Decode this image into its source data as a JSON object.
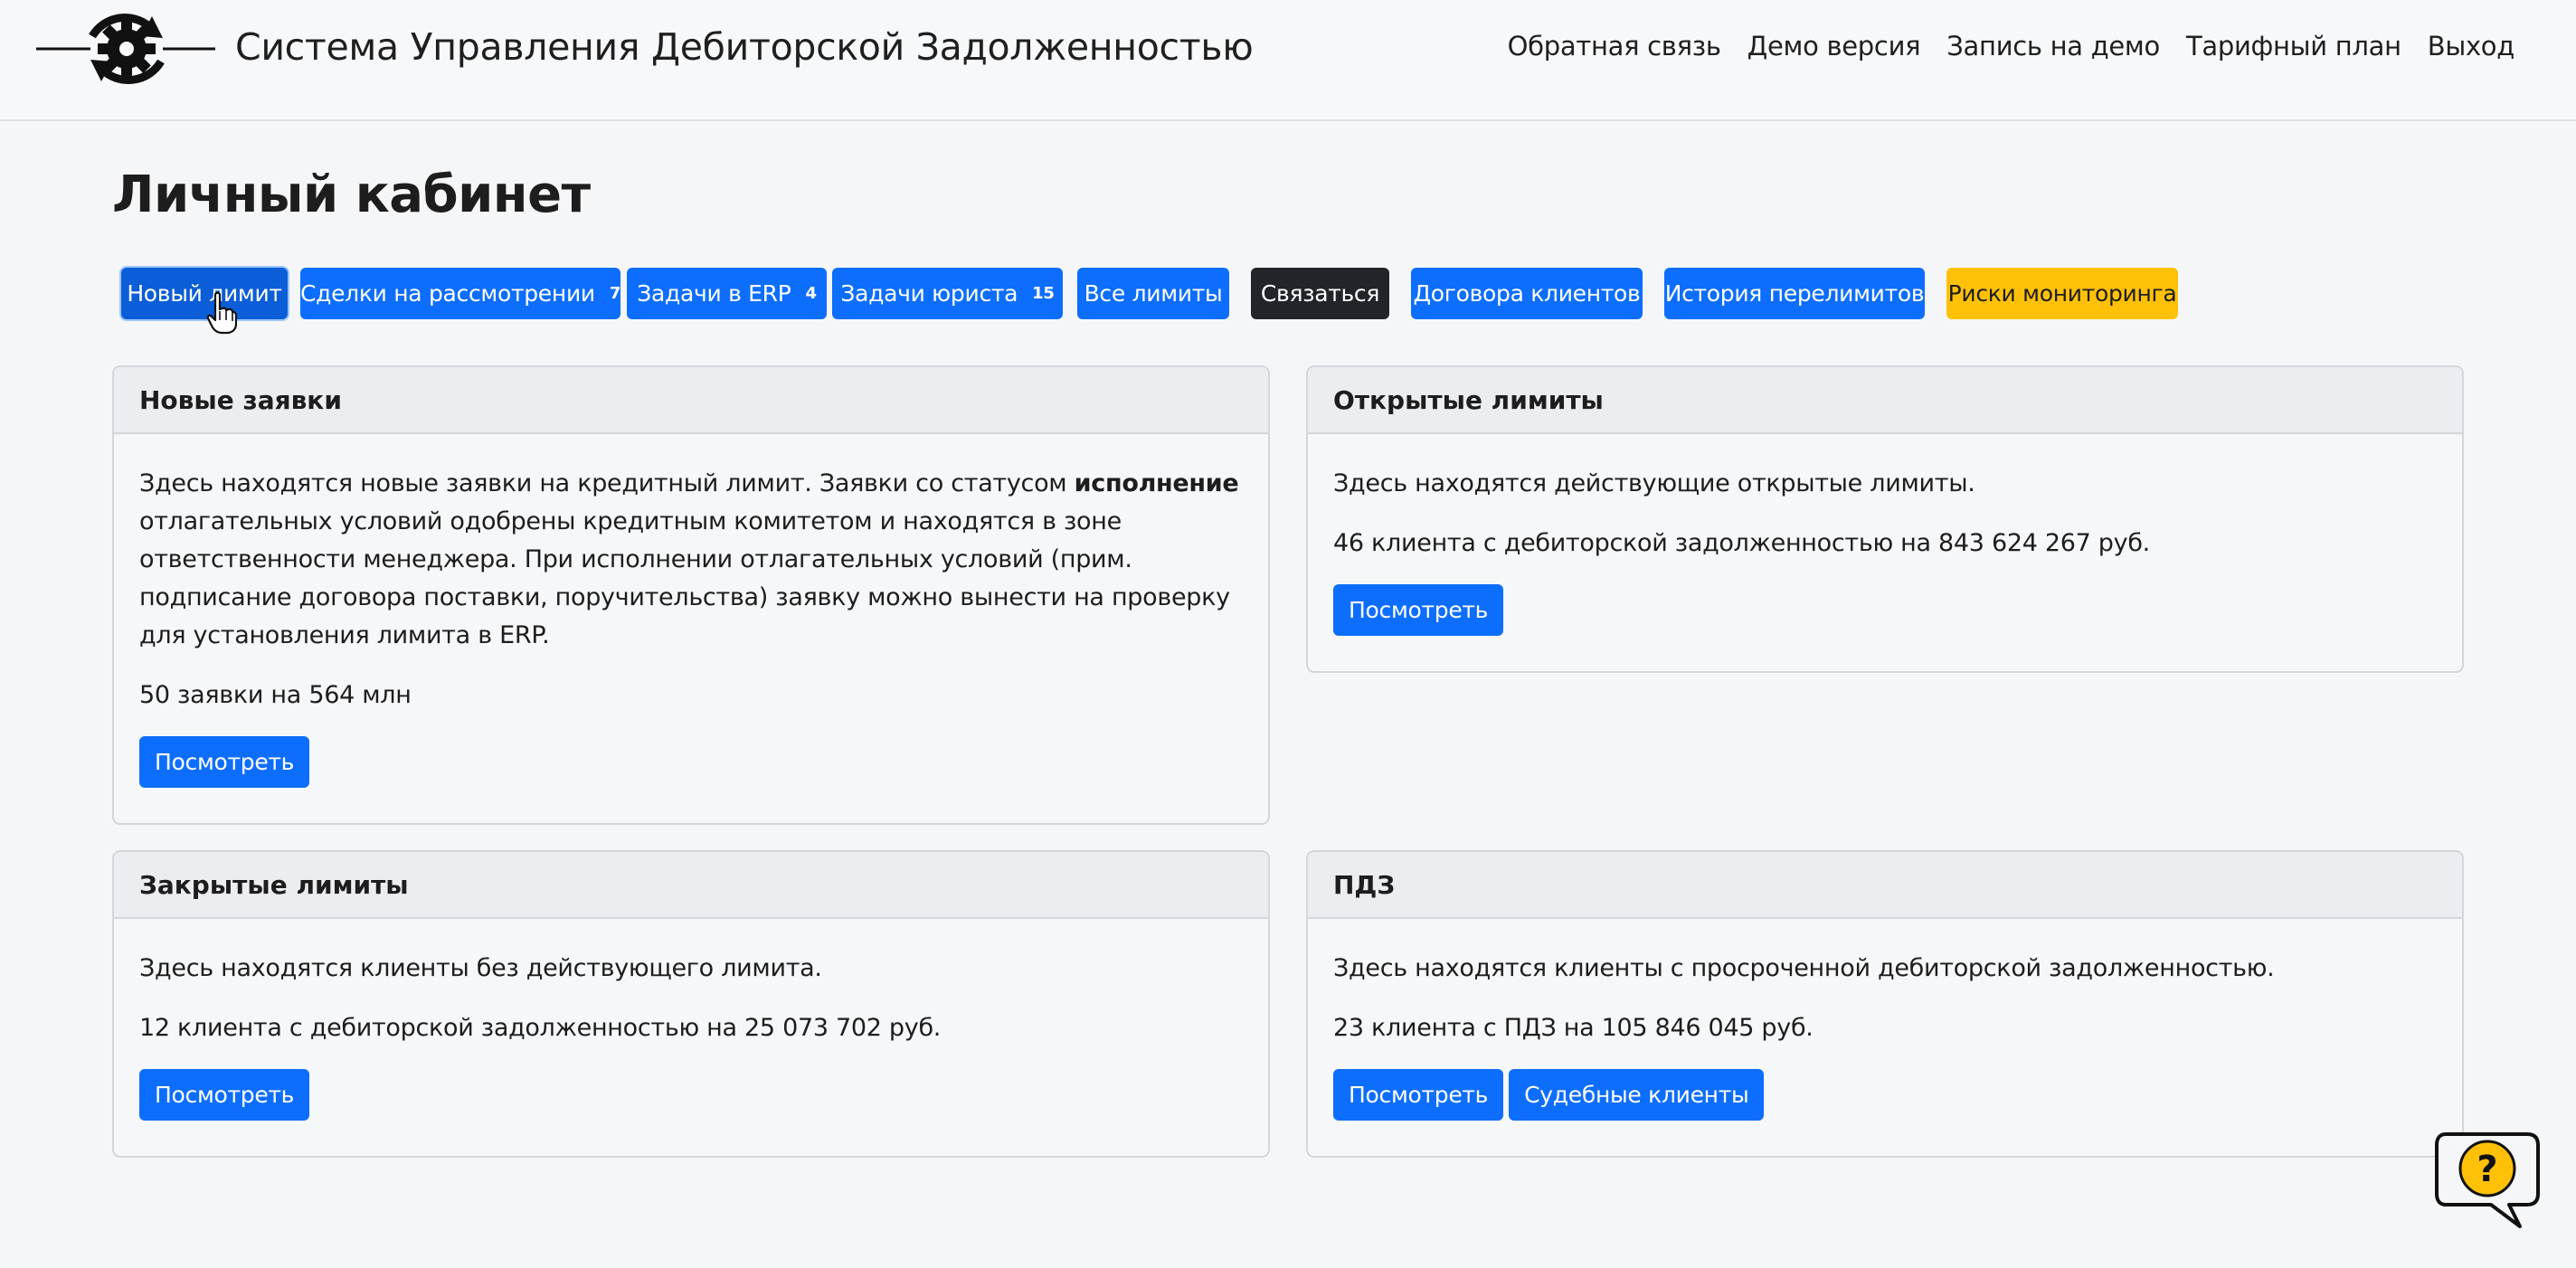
{
  "header": {
    "brand_title": "Система Управления Дебиторской Задолженностью",
    "logo_icon": "gear-refresh-icon",
    "nav": [
      {
        "label": "Обратная связь"
      },
      {
        "label": "Демо версия"
      },
      {
        "label": "Запись на демо"
      },
      {
        "label": "Тарифный план"
      },
      {
        "label": "Выход"
      }
    ]
  },
  "page": {
    "title": "Личный кабинет"
  },
  "toolbar": {
    "buttons": [
      {
        "label": "Новый лимит",
        "badge": "",
        "state": "hover"
      },
      {
        "label": "Сделки на рассмотрении",
        "badge": "7"
      },
      {
        "label": "Задачи в ERP",
        "badge": "4"
      },
      {
        "label": "Задачи юриста",
        "badge": "15"
      },
      {
        "label": "Все лимиты",
        "badge": ""
      },
      {
        "label": "Связаться",
        "badge": ""
      },
      {
        "label": "Договора клиентов",
        "badge": ""
      },
      {
        "label": "История перелимитов",
        "badge": ""
      },
      {
        "label": "Риски мониторинга",
        "badge": ""
      }
    ]
  },
  "cards": {
    "new_requests": {
      "title": "Новые заявки",
      "text_before_bold": "Здесь находятся новые заявки на кредитный лимит. Заявки со статусом ",
      "text_bold": "исполнение",
      "text_after_bold": " отлагательных условий одобрены кредитным комитетом и находятся в зоне ответственности менеджера. При исполнении отлагательных условий (прим. подписание договора поставки, поручительства) заявку можно вынести на проверку для установления лимита в ERP.",
      "summary": "50 заявки на 564 млн",
      "button": "Посмотреть"
    },
    "open_limits": {
      "title": "Открытые лимиты",
      "text": "Здесь находятся действующие открытые лимиты.",
      "summary": "46 клиента с дебиторской задолженностью на 843 624 267 руб.",
      "button": "Посмотреть"
    },
    "closed_limits": {
      "title": "Закрытые лимиты",
      "text": "Здесь находятся клиенты без действующего лимита.",
      "summary": "12 клиента с дебиторской задолженностью на 25 073 702 руб.",
      "button": "Посмотреть"
    },
    "pdz": {
      "title": "ПДЗ",
      "text": "Здесь находятся клиенты с просроченной дебиторской задолженностью.",
      "summary": "23 клиента с ПДЗ на 105 846 045 руб.",
      "button": "Посмотреть",
      "button2": "Судебные клиенты"
    }
  },
  "colors": {
    "primary": "#0d6efd",
    "dark": "#212529",
    "warning": "#ffc107",
    "help_bubble": "#ffc107"
  },
  "icons": {
    "cursor": "hand-pointer-icon",
    "help": "help-question-icon"
  }
}
